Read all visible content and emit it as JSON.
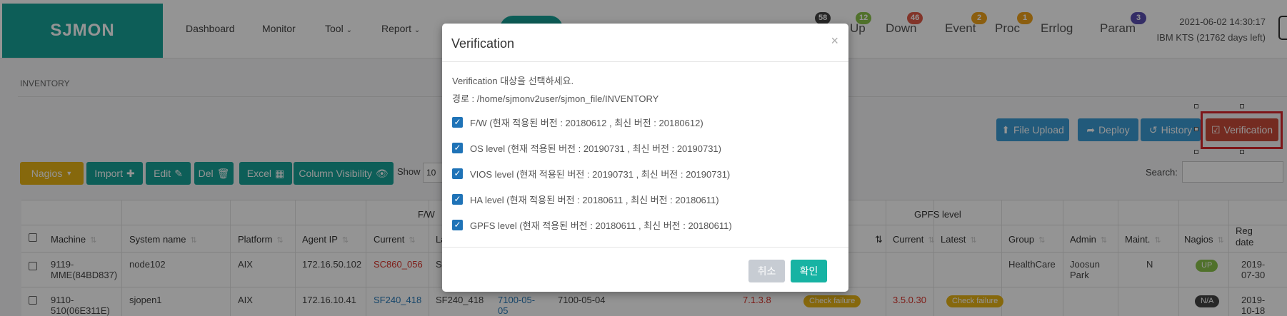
{
  "brand": "SJMON",
  "nav": [
    "Dashboard",
    "Monitor",
    "Tool",
    "Report"
  ],
  "status": {
    "items": [
      {
        "label": "Up",
        "count": "12",
        "color": "#8bc34a"
      },
      {
        "label": "Down",
        "count": "46",
        "color": "#e05a47"
      },
      {
        "label": "Event",
        "count": "2",
        "color": "#f0a21a"
      },
      {
        "label": "Proc",
        "count": "1",
        "color": "#f0a21a"
      },
      {
        "label": "Errlog",
        "count": ""
      },
      {
        "label": "Param",
        "count": "3",
        "color": "#5b4fb0"
      }
    ],
    "total_badge": "58"
  },
  "clock": {
    "datetime": "2021-06-02 14:30:17",
    "license": "IBM KTS (21762 days left)"
  },
  "breadcrumb": "INVENTORY",
  "toolbar_right": {
    "file_upload": "File Upload",
    "deploy": "Deploy",
    "history": "History",
    "verification": "Verification"
  },
  "toolbar_left": {
    "nagios": "Nagios",
    "import": "Import",
    "edit": "Edit",
    "del": "Del",
    "excel": "Excel",
    "column_visibility": "Column Visibility",
    "show_label": "Show",
    "show_value": "10",
    "search_label": "Search:"
  },
  "table": {
    "group_headers": {
      "fw": "F/W",
      "gpfs": "GPFS level"
    },
    "headers": {
      "machine": "Machine",
      "system_name": "System name",
      "platform": "Platform",
      "agent_ip": "Agent IP",
      "current": "Current",
      "latest_partial": "La",
      "gpfs_current": "Current",
      "gpfs_latest": "Latest",
      "group": "Group",
      "admin": "Admin",
      "maint": "Maint.",
      "nagios": "Nagios",
      "reg_date": "Reg date"
    },
    "rows": [
      {
        "machine": "9119-MME(84BD837)",
        "system_name": "node102",
        "platform": "AIX",
        "agent_ip": "172.16.50.102",
        "fw_current": "SC860_056",
        "fw_latest": "S",
        "group": "HealthCare",
        "admin": "Joosun Park",
        "maint": "N",
        "nagios": "UP",
        "reg_date": "2019-07-30"
      },
      {
        "machine": "9110-510(06E311E)",
        "system_name": "sjopen1",
        "platform": "AIX",
        "agent_ip": "172.16.10.41",
        "fw_current": "SF240_418",
        "fw_latest": "SF240_418",
        "os_current": "7100-05-05",
        "os_latest": "7100-05-04",
        "ha_current": "7.1.3.8",
        "ha_status": "Check failure",
        "gpfs_current": "3.5.0.30",
        "gpfs_status": "Check failure",
        "nagios": "N/A",
        "reg_date": "2019-10-18"
      }
    ]
  },
  "modal": {
    "title": "Verification",
    "close": "×",
    "instruction": "Verification 대상을 선택하세요.",
    "path": "경로 : /home/sjmonv2user/sjmon_file/INVENTORY",
    "options": [
      "F/W (현재 적용된 버전 : 20180612 , 최신 버전 : 20180612)",
      "OS level (현재 적용된 버전 : 20190731 , 최신 버전 : 20190731)",
      "VIOS level (현재 적용된 버전 : 20190731 , 최신 버전 : 20190731)",
      "HA level (현재 적용된 버전 : 20180611 , 최신 버전 : 20180611)",
      "GPFS level (현재 적용된 버전 : 20180611 , 최신 버전 : 20180611)"
    ],
    "cancel": "취소",
    "confirm": "확인"
  },
  "colors": {
    "brand": "#17a398",
    "accent_blue": "#3b9bd4",
    "confirm": "#17b3a3",
    "cancel": "#c7ccd3",
    "danger": "#c84b3a",
    "warning": "#e7b416",
    "link": "#2a7ab8"
  },
  "icons": {
    "file_upload": "upload-icon",
    "deploy": "share-icon",
    "history": "history-icon",
    "verification": "check-square-icon",
    "import": "plus-icon",
    "edit": "edit-icon",
    "del": "trash-icon",
    "excel": "table-icon",
    "column_visibility": "eye-slash-icon",
    "dropdown": "caret-down-icon",
    "checkbox": "check-icon",
    "close": "close-icon"
  }
}
